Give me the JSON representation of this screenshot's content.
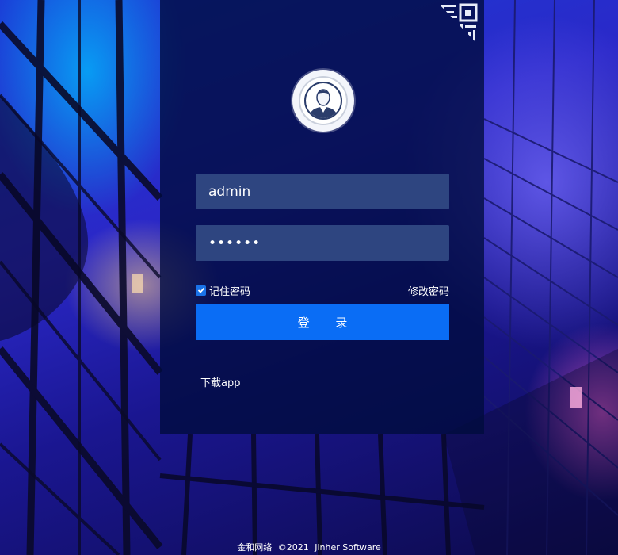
{
  "background": {
    "description": "night-lit glass building facade",
    "colors": [
      "#1a3fd8",
      "#2a28c8",
      "#0c0a4a",
      "#00beff",
      "#e65ac8"
    ]
  },
  "login_panel": {
    "qr_icon": "qr-code-corner-icon",
    "avatar_icon": "user-avatar-icon",
    "username": {
      "value": "admin",
      "placeholder": ""
    },
    "password": {
      "value": "abcdef",
      "placeholder": ""
    },
    "remember_label": "记住密码",
    "remember_checked": true,
    "modify_password_label": "修改密码",
    "login_label": "登 录",
    "download_label": "下载app",
    "accent_color": "#0a6df5"
  },
  "footer": {
    "company": "金和网络",
    "copyright": "©2021",
    "software": "Jinher Software"
  }
}
